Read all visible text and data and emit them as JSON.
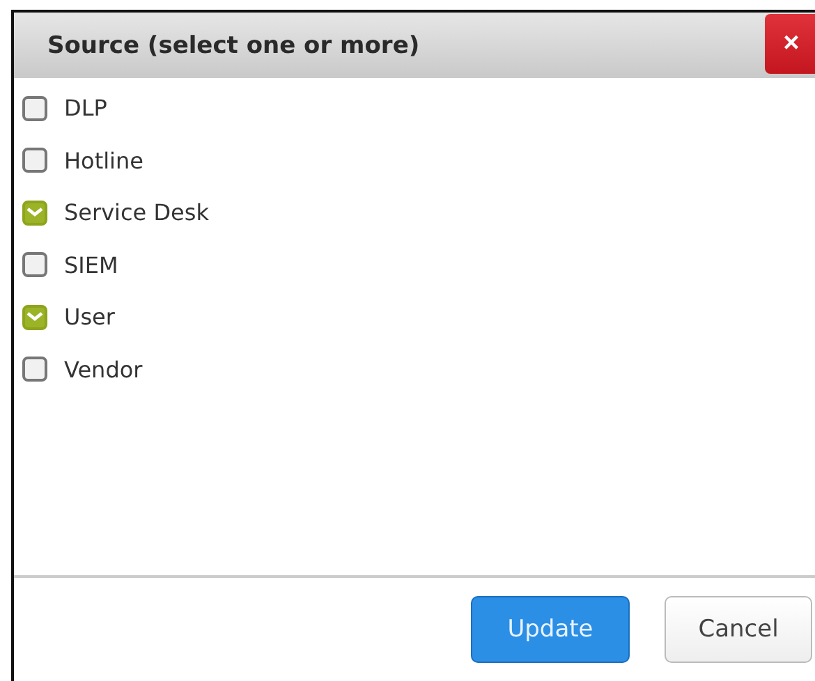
{
  "dialog": {
    "title": "Source (select one or more)",
    "close_label": "×",
    "options": [
      {
        "label": "DLP",
        "checked": false
      },
      {
        "label": "Hotline",
        "checked": false
      },
      {
        "label": "Service Desk",
        "checked": true
      },
      {
        "label": "SIEM",
        "checked": false
      },
      {
        "label": "User",
        "checked": true
      },
      {
        "label": "Vendor",
        "checked": false
      }
    ],
    "buttons": [
      {
        "label": "Update",
        "kind": "primary"
      },
      {
        "label": "Cancel",
        "kind": "secondary"
      }
    ]
  }
}
